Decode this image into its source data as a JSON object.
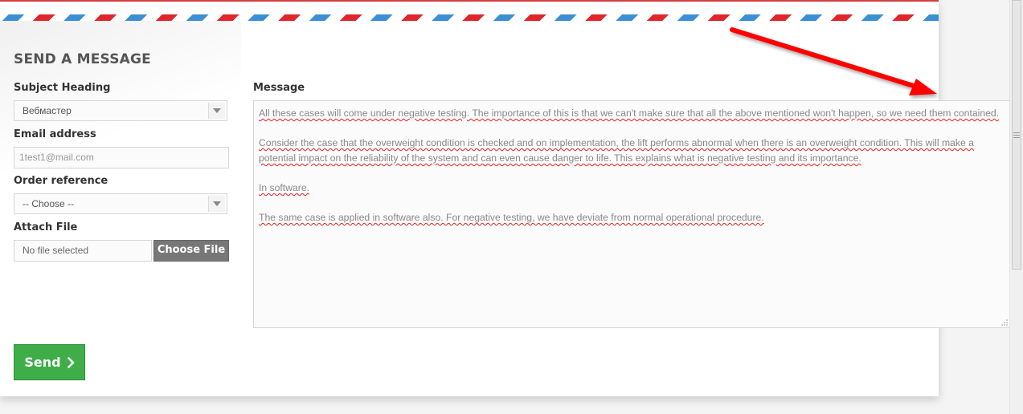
{
  "form": {
    "title": "SEND A MESSAGE",
    "subject_label": "Subject Heading",
    "subject_value": "Вебмастер",
    "email_label": "Email address",
    "email_value": "1test1@mail.com",
    "order_label": "Order reference",
    "order_value": "-- Choose --",
    "attach_label": "Attach File",
    "file_status": "No file selected",
    "choose_file_label": "Choose File",
    "message_label": "Message",
    "message_paragraphs": [
      "All these cases will come under negative testing. The importance of this is that we can't make sure that all the above mentioned won't happen, so we need them contained.",
      "Consider the case that the overweight condition is checked and on implementation, the lift performs abnormal when there is an overweight condition. This will make a potential impact on the reliability of the system and can even cause danger to life. This explains what is negative testing and its importance.",
      "In software.",
      "The same case is applied in software also. For negative testing, we have deviate from normal operational procedure."
    ],
    "send_label": "Send"
  },
  "icons": {
    "dropdown": "chevron-down-icon",
    "send": "chevron-right-icon",
    "annotation": "red-arrow-icon"
  },
  "colors": {
    "send_button": "#3fae49",
    "stripe_red": "#e0262a",
    "stripe_blue": "#3b8fd4",
    "annotation_arrow": "#ff0000"
  }
}
